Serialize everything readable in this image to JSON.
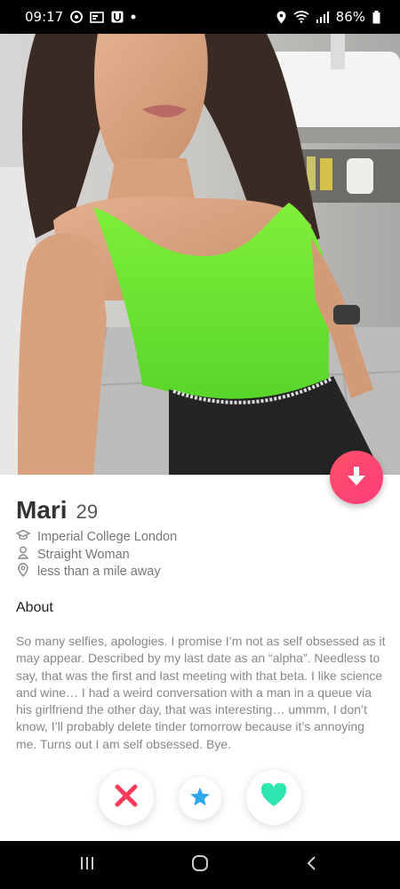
{
  "status_bar": {
    "time": "09:17",
    "battery": "86%"
  },
  "profile": {
    "name": "Mari",
    "age": "29",
    "school": "Imperial College London",
    "orientation": "Straight Woman",
    "distance": "less than a mile away"
  },
  "about": {
    "title": "About",
    "bio": "So many selfies, apologies. I promise I’m not as self obsessed as it may appear. Described by my last date as an “alpha”. Needless to say, that was the first and last meeting with that beta. I like science and wine… I had a weird conversation with a man in a queue via his girlfriend the other day, that was interesting… ummm, I don’t know, I’ll probably delete tinder tomorrow because it’s annoying me. Turns out I am self obsessed. Bye."
  },
  "colors": {
    "accent": "#fd5068",
    "nope": "#fd3a5c",
    "superlike": "#2ea7ee",
    "like": "#2ee6b0"
  },
  "icons": [
    "signal-icon",
    "wifi-icon",
    "location-icon",
    "school-icon",
    "person-icon",
    "location-pin-icon",
    "x-icon",
    "star-icon",
    "heart-icon",
    "down-arrow-icon"
  ]
}
